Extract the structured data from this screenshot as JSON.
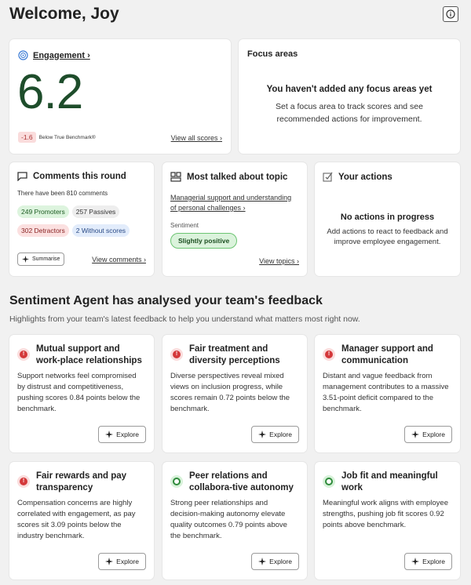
{
  "header": {
    "title": "Welcome, Joy"
  },
  "engagement": {
    "label": "Engagement ›",
    "score": "6.2",
    "delta": "-1.6",
    "delta_text": "Below True Benchmark®",
    "view_all": "View all scores ›"
  },
  "focus": {
    "title": "Focus areas",
    "empty_title": "You haven't added any focus areas yet",
    "empty_text": "Set a focus area to track scores and see recommended actions for improvement."
  },
  "comments": {
    "title": "Comments this round",
    "summary": "There have been 810 comments",
    "promoters": "249 Promoters",
    "passives": "257 Passives",
    "detractors": "302 Detractors",
    "without": "2 Without scores",
    "summarise": "Summarise",
    "view": "View comments ›"
  },
  "topic": {
    "title": "Most talked about topic",
    "link": "Managerial support and understanding of personal challenges ›",
    "sentiment_label": "Sentiment",
    "sentiment_value": "Slightly positive",
    "view": "View topics ›"
  },
  "actions": {
    "title": "Your actions",
    "empty_title": "No actions in progress",
    "empty_text": "Add actions to react to feedback and improve employee engagement."
  },
  "agent": {
    "title": "Sentiment Agent has analysed your team's feedback",
    "subtitle": "Highlights from your team's latest feedback to help you understand what matters most right now.",
    "explore_label": "Explore",
    "cards": [
      {
        "title": "Mutual support and work-place relationships",
        "status": "negative",
        "body": "Support networks feel compromised by distrust and competitiveness, pushing scores 0.84 points below the benchmark."
      },
      {
        "title": "Fair treatment and diversity perceptions",
        "status": "negative",
        "body": "Diverse perspectives reveal mixed views on inclusion progress, while scores remain 0.72 points below the benchmark."
      },
      {
        "title": "Manager support and communication",
        "status": "negative",
        "body": "Distant and vague feedback from management contributes to a massive 3.51-point deficit compared to the benchmark."
      },
      {
        "title": "Fair rewards and pay transparency",
        "status": "negative",
        "body": "Compensation concerns are highly correlated with engagement, as pay scores sit 3.09 points below the industry benchmark."
      },
      {
        "title": "Peer relations and collabora-tive autonomy",
        "status": "positive",
        "body": "Strong peer relationships and decision-making autonomy elevate quality outcomes 0.79 points above the benchmark."
      },
      {
        "title": "Job fit and meaningful work",
        "status": "positive",
        "body": "Meaningful work aligns with employee strengths, pushing job fit scores 0.92 points above benchmark."
      }
    ]
  },
  "colors": {
    "score_green": "#1e4d2b",
    "negative": "#d4383a",
    "positive": "#2f8b3b",
    "background": "#f1f1f1"
  }
}
